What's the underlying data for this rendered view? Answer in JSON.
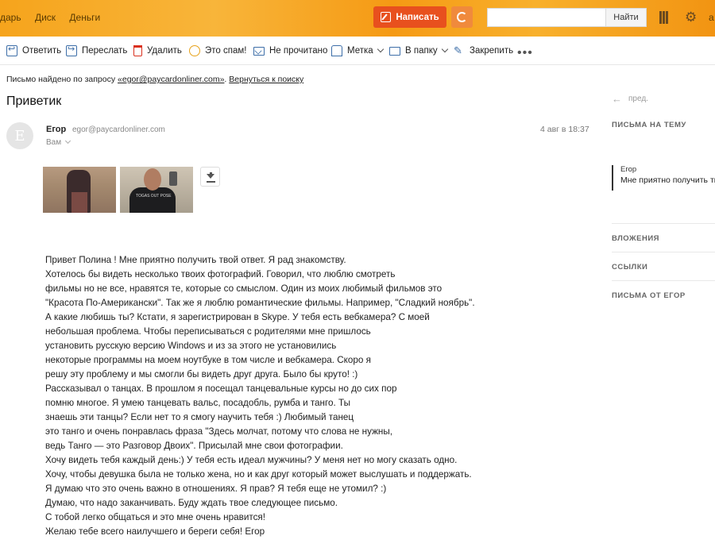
{
  "header": {
    "nav": [
      "дарь",
      "Диск",
      "Деньги"
    ],
    "compose_label": "Написать",
    "search_button": "Найти",
    "search_placeholder": "",
    "account_letter": "а"
  },
  "toolbar": {
    "reply": "Ответить",
    "forward": "Переслать",
    "delete": "Удалить",
    "spam": "Это спам!",
    "unread": "Не прочитано",
    "label": "Метка",
    "folder": "В папку",
    "pin": "Закрепить"
  },
  "search_note": {
    "prefix": "Письмо найдено по запросу ",
    "query": "«egor@paycardonliner.com»",
    "back_link": "Вернуться к поиску"
  },
  "message": {
    "subject": "Приветик",
    "avatar_letter": "Е",
    "sender_name": "Егор",
    "sender_email": "egor@paycardonliner.com",
    "recipient": "Вам",
    "date": "4 авг в 18:37",
    "attachments": [
      "photo-1",
      "photo-2"
    ],
    "body": [
      "Привет Полина ! Мне приятно получить твой ответ. Я рад знакомству.",
      "Хотелось бы видеть несколько твоих фотографий. Говорил, что люблю смотреть",
      "фильмы но не все, нравятся те, которые со смыслом. Один из моих любимый фильмов это",
      "\"Красота По-Американски\". Так же я люблю романтические фильмы. Например, \"Сладкий ноябрь\".",
      "А какие любишь ты? Кстати, я зарегистрирован в Skype. У тебя есть вебкамера? С моей",
      "небольшая проблема. Чтобы переписываться с родителями мне пришлось",
      "установить русскую версию Windows и из за этого не установились",
      "некоторые программы на моем ноутбуке в том числе и вебкамера. Скоро я",
      "решу эту проблему и мы смогли бы видеть друг друга. Было бы круто! :)",
      "Рассказывал о танцах. В прошлом я посещал танцевальные курсы но до сих пор",
      "помню многое. Я умею танцевать вальс, посадобль, румба и танго. Ты",
      "знаешь эти танцы? Если нет то я смогу научить тебя :) Любимый танец",
      "это танго и очень понравлась фраза \"Здесь молчат, потому что слова не нужны,",
      "ведь Танго — это Разговор Двоих\". Присылай мне свои фотографии.",
      "Хочу видеть тебя каждый день:) У тебя есть идеал мужчины? У меня нет но могу сказать одно.",
      "Хочу, чтобы девушка была не только жена, но и как друг который может выслушать и поддержать.",
      "Я думаю что это очень важно в отношениях. Я прав? Я тебя еще не утомил? :)",
      "Думаю, что надо заканчивать. Буду ждать твое следующее письмо.",
      "С тобой легко общаться и это мне очень нравится!",
      "Желаю тебе всего наилучшего и береги себя! Егор"
    ]
  },
  "sidebar": {
    "prev": "пред.",
    "related_title": "ПИСЬМА НА ТЕМУ",
    "thread_from": "Егор",
    "thread_snippet": "Мне приятно получить тв",
    "attachments_title": "ВЛОЖЕНИЯ",
    "links_title": "ССЫЛКИ",
    "from_title": "ПИСЬМА ОТ ЕГОР"
  },
  "colors": {
    "compose": "#e8501e",
    "header": "#f6a41c",
    "link": "#3d6ea8"
  }
}
